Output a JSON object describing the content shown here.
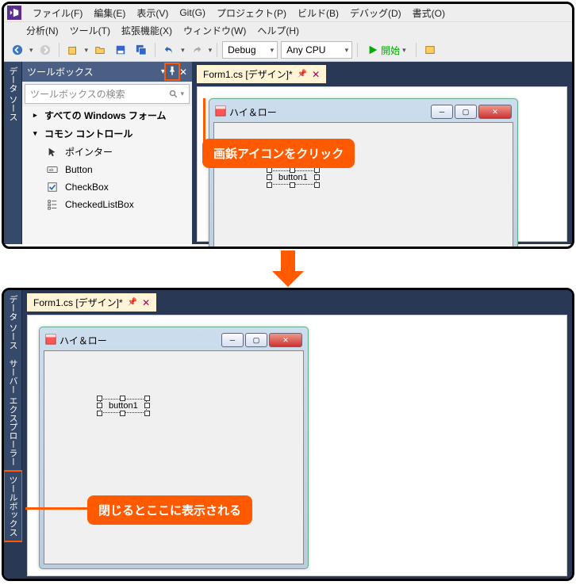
{
  "menu": {
    "row1": [
      "ファイル(F)",
      "編集(E)",
      "表示(V)",
      "Git(G)",
      "プロジェクト(P)",
      "ビルド(B)",
      "デバッグ(D)",
      "書式(O)"
    ],
    "row2": [
      "分析(N)",
      "ツール(T)",
      "拡張機能(X)",
      "ウィンドウ(W)",
      "ヘルプ(H)"
    ]
  },
  "toolbar": {
    "config": "Debug",
    "platform": "Any CPU",
    "start": "開始"
  },
  "side_tabs": {
    "data_sources": "データ ソース",
    "server_explorer": "サーバー エクスプローラー",
    "toolbox": "ツールボックス"
  },
  "toolbox": {
    "title": "ツールボックス",
    "search_placeholder": "ツールボックスの検索",
    "groups": [
      {
        "label": "すべての Windows フォーム",
        "open": false
      },
      {
        "label": "コモン コントロール",
        "open": true,
        "items": [
          {
            "icon": "pointer",
            "label": "ポインター"
          },
          {
            "icon": "button",
            "label": "Button"
          },
          {
            "icon": "checkbox",
            "label": "CheckBox"
          },
          {
            "icon": "checkedlist",
            "label": "CheckedListBox"
          }
        ]
      }
    ]
  },
  "tabs": {
    "form_design": "Form1.cs [デザイン]*"
  },
  "form": {
    "title": "ハイ＆ロー",
    "button_text": "button1"
  },
  "callouts": {
    "c1": "画鋲アイコンをクリック",
    "c2": "閉じるとここに表示される"
  }
}
